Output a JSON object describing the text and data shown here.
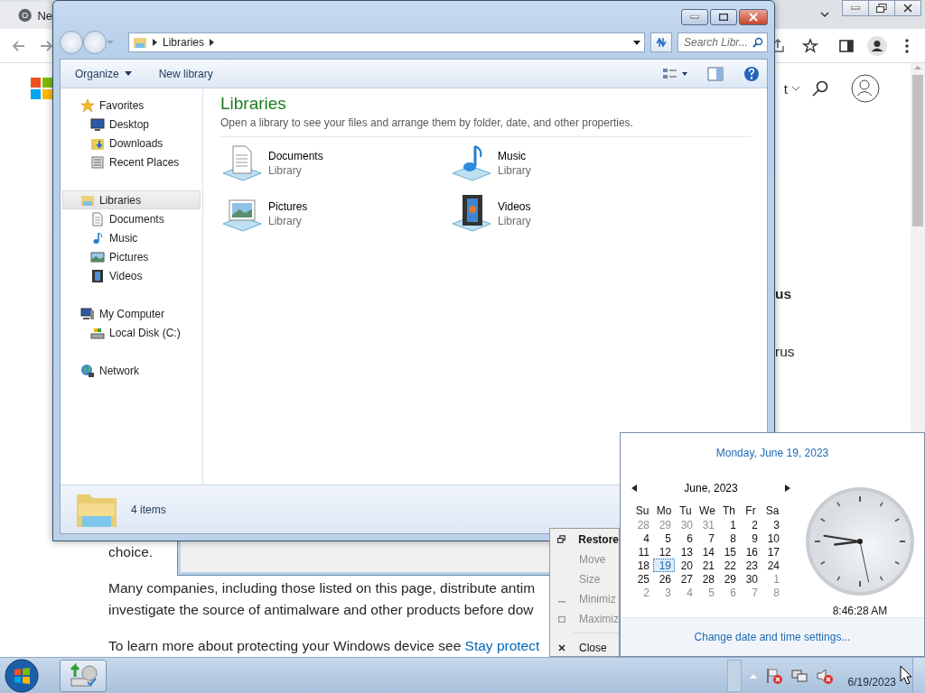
{
  "browser": {
    "tab": {
      "title": "Ne"
    },
    "page": {
      "nav_partial": "t",
      "fragments": [
        {
          "text": "us",
          "bold": true
        },
        {
          "text": "rus",
          "bold": false
        }
      ],
      "paragraphs": [
        {
          "lines": [
            "choice."
          ]
        },
        {
          "lines": [
            "Many companies, including those listed on this page, distribute antim",
            "investigate the source of antimalware and other products before dow"
          ]
        },
        {
          "lines": [
            "To learn more about protecting your Windows device see "
          ],
          "link": "Stay protect"
        }
      ]
    }
  },
  "explorer": {
    "breadcrumb": "Libraries",
    "search": {
      "placeholder": "Search Libr..."
    },
    "toolbar": [
      "Organize",
      "New library"
    ],
    "nav": [
      {
        "label": "Favorites",
        "kind": "star",
        "selected": false,
        "children": [
          {
            "label": "Desktop",
            "kind": "desktop",
            "selected": false
          },
          {
            "label": "Downloads",
            "kind": "downloads",
            "selected": false
          },
          {
            "label": "Recent Places",
            "kind": "recent",
            "selected": false
          }
        ]
      },
      {
        "label": "Libraries",
        "kind": "libraries",
        "selected": true,
        "children": [
          {
            "label": "Documents",
            "kind": "documents",
            "selected": false
          },
          {
            "label": "Music",
            "kind": "music",
            "selected": false
          },
          {
            "label": "Pictures",
            "kind": "pictures",
            "selected": false
          },
          {
            "label": "Videos",
            "kind": "videos",
            "selected": false
          }
        ]
      },
      {
        "label": "My Computer",
        "kind": "computer",
        "selected": false,
        "children": [
          {
            "label": "Local Disk (C:)",
            "kind": "disk",
            "selected": false
          }
        ]
      },
      {
        "label": "Network",
        "kind": "network",
        "selected": false
      }
    ],
    "heading": "Libraries",
    "subtitle": "Open a library to see your files and arrange them by folder, date, and other properties.",
    "items": [
      {
        "name": "Documents",
        "type": "Library",
        "kind": "documents"
      },
      {
        "name": "Music",
        "type": "Library",
        "kind": "music"
      },
      {
        "name": "Pictures",
        "type": "Library",
        "kind": "pictures"
      },
      {
        "name": "Videos",
        "type": "Library",
        "kind": "videos"
      }
    ],
    "status": "4 items"
  },
  "context_menu": {
    "items": [
      {
        "label": "Restore",
        "kind": "restore",
        "default": true,
        "disabled": false
      },
      {
        "label": "Move",
        "kind": "plain",
        "default": false,
        "disabled": true
      },
      {
        "label": "Size",
        "kind": "plain",
        "default": false,
        "disabled": true
      },
      {
        "label": "Minimiz",
        "kind": "minimize",
        "default": false,
        "disabled": true
      },
      {
        "label": "Maximiz",
        "kind": "maximize",
        "default": false,
        "disabled": true
      },
      {
        "kind": "separator"
      },
      {
        "label": "Close",
        "kind": "close",
        "default": false,
        "disabled": false
      }
    ]
  },
  "calendar": {
    "long_date": "Monday, June 19, 2023",
    "month": "June, 2023",
    "weekdays": [
      "Su",
      "Mo",
      "Tu",
      "We",
      "Th",
      "Fr",
      "Sa"
    ],
    "weeks": [
      [
        {
          "day": "28",
          "in_month": false,
          "selected": false
        },
        {
          "day": "29",
          "in_month": false,
          "selected": false
        },
        {
          "day": "30",
          "in_month": false,
          "selected": false
        },
        {
          "day": "31",
          "in_month": false,
          "selected": false
        },
        {
          "day": "1",
          "in_month": true,
          "selected": false
        },
        {
          "day": "2",
          "in_month": true,
          "selected": false
        },
        {
          "day": "3",
          "in_month": true,
          "selected": false
        }
      ],
      [
        {
          "day": "4",
          "in_month": true,
          "selected": false
        },
        {
          "day": "5",
          "in_month": true,
          "selected": false
        },
        {
          "day": "6",
          "in_month": true,
          "selected": false
        },
        {
          "day": "7",
          "in_month": true,
          "selected": false
        },
        {
          "day": "8",
          "in_month": true,
          "selected": false
        },
        {
          "day": "9",
          "in_month": true,
          "selected": false
        },
        {
          "day": "10",
          "in_month": true,
          "selected": false
        }
      ],
      [
        {
          "day": "11",
          "in_month": true,
          "selected": false
        },
        {
          "day": "12",
          "in_month": true,
          "selected": false
        },
        {
          "day": "13",
          "in_month": true,
          "selected": false
        },
        {
          "day": "14",
          "in_month": true,
          "selected": false
        },
        {
          "day": "15",
          "in_month": true,
          "selected": false
        },
        {
          "day": "16",
          "in_month": true,
          "selected": false
        },
        {
          "day": "17",
          "in_month": true,
          "selected": false
        }
      ],
      [
        {
          "day": "18",
          "in_month": true,
          "selected": false
        },
        {
          "day": "19",
          "in_month": true,
          "selected": true
        },
        {
          "day": "20",
          "in_month": true,
          "selected": false
        },
        {
          "day": "21",
          "in_month": true,
          "selected": false
        },
        {
          "day": "22",
          "in_month": true,
          "selected": false
        },
        {
          "day": "23",
          "in_month": true,
          "selected": false
        },
        {
          "day": "24",
          "in_month": true,
          "selected": false
        }
      ],
      [
        {
          "day": "25",
          "in_month": true,
          "selected": false
        },
        {
          "day": "26",
          "in_month": true,
          "selected": false
        },
        {
          "day": "27",
          "in_month": true,
          "selected": false
        },
        {
          "day": "28",
          "in_month": true,
          "selected": false
        },
        {
          "day": "29",
          "in_month": true,
          "selected": false
        },
        {
          "day": "30",
          "in_month": true,
          "selected": false
        },
        {
          "day": "1",
          "in_month": false,
          "selected": false
        }
      ],
      [
        {
          "day": "2",
          "in_month": false,
          "selected": false
        },
        {
          "day": "3",
          "in_month": false,
          "selected": false
        },
        {
          "day": "4",
          "in_month": false,
          "selected": false
        },
        {
          "day": "5",
          "in_month": false,
          "selected": false
        },
        {
          "day": "6",
          "in_month": false,
          "selected": false
        },
        {
          "day": "7",
          "in_month": false,
          "selected": false
        },
        {
          "day": "8",
          "in_month": false,
          "selected": false
        }
      ]
    ],
    "time": "8:46:28 AM",
    "settings_link": "Change date and time settings..."
  },
  "taskbar": {
    "date": "6/19/2023"
  }
}
